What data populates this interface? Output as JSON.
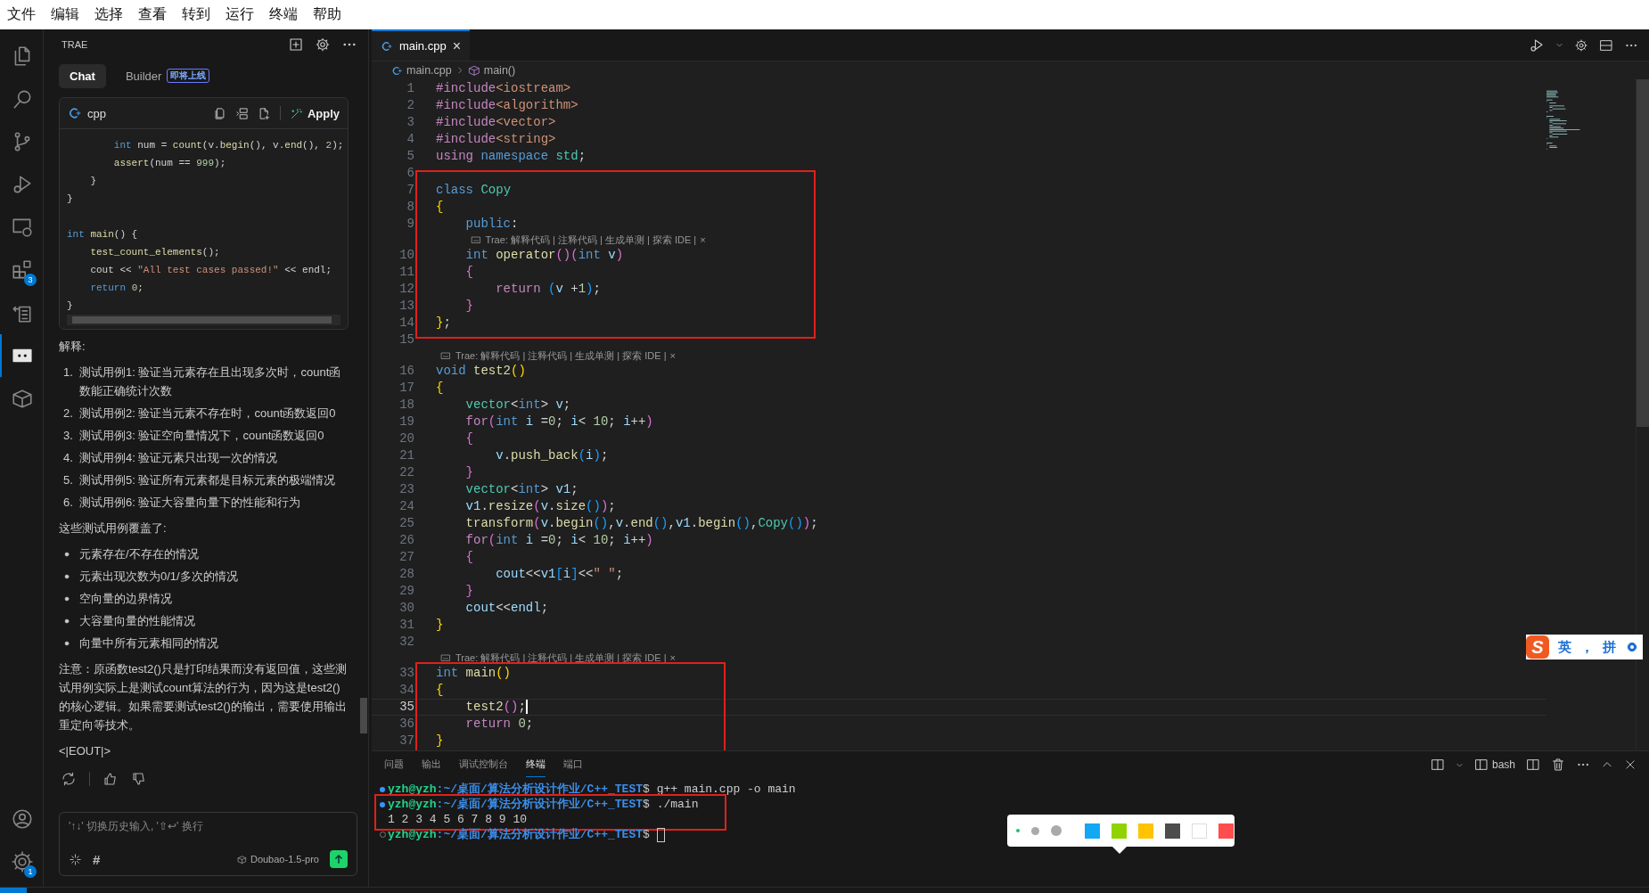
{
  "menu": [
    "文件",
    "编辑",
    "选择",
    "查看",
    "转到",
    "运行",
    "终端",
    "帮助"
  ],
  "activity_bar": {
    "items": [
      {
        "kind": "files",
        "selected": false
      },
      {
        "kind": "search",
        "selected": false
      },
      {
        "kind": "source-control",
        "selected": false
      },
      {
        "kind": "run-debug",
        "selected": false
      },
      {
        "kind": "remote",
        "selected": false
      },
      {
        "kind": "extensions",
        "selected": false,
        "badge": "3"
      },
      {
        "kind": "tasks",
        "selected": false
      },
      {
        "kind": "chat",
        "selected": true
      },
      {
        "kind": "box",
        "selected": false
      }
    ],
    "bottom": [
      {
        "kind": "account"
      },
      {
        "kind": "settings",
        "badge": "1"
      }
    ]
  },
  "chat_panel": {
    "title": "TRAE",
    "tabs": [
      {
        "label": "Chat",
        "selected": true
      },
      {
        "label": "Builder",
        "selected": false,
        "badge": "即将上线"
      }
    ],
    "code_block": {
      "language": "cpp",
      "apply": "Apply",
      "lines": [
        {
          "kind": "code",
          "tokens": [
            {
              "text": "        int",
              "kind": "kw"
            },
            {
              "text": " num = ",
              "kind": "p"
            },
            {
              "text": "count",
              "kind": "fn"
            },
            {
              "text": "(v.",
              "kind": "p"
            },
            {
              "text": "begin",
              "kind": "fn"
            },
            {
              "text": "(), v.",
              "kind": "p"
            },
            {
              "text": "end",
              "kind": "fn"
            },
            {
              "text": "(), ",
              "kind": "p"
            },
            {
              "text": "2",
              "kind": "num"
            },
            {
              "text": ");",
              "kind": "p"
            }
          ]
        },
        {
          "kind": "code",
          "tokens": [
            {
              "text": "        assert",
              "kind": "fn"
            },
            {
              "text": "(num == ",
              "kind": "p"
            },
            {
              "text": "999",
              "kind": "num"
            },
            {
              "text": ");",
              "kind": "p"
            }
          ]
        },
        {
          "kind": "code",
          "tokens": [
            {
              "text": "    }",
              "kind": "p"
            }
          ]
        },
        {
          "kind": "code",
          "tokens": [
            {
              "text": "}",
              "kind": "p"
            }
          ]
        },
        {
          "kind": "blank"
        },
        {
          "kind": "code",
          "tokens": [
            {
              "text": "int ",
              "kind": "kw"
            },
            {
              "text": "main",
              "kind": "fn"
            },
            {
              "text": "() {",
              "kind": "p"
            }
          ]
        },
        {
          "kind": "code",
          "tokens": [
            {
              "text": "    test_count_elements",
              "kind": "fn"
            },
            {
              "text": "();",
              "kind": "p"
            }
          ]
        },
        {
          "kind": "code",
          "tokens": [
            {
              "text": "    cout << ",
              "kind": "p"
            },
            {
              "text": "\"All test cases passed!\"",
              "kind": "str"
            },
            {
              "text": " << endl;",
              "kind": "p"
            }
          ]
        },
        {
          "kind": "code",
          "tokens": [
            {
              "text": "    return ",
              "kind": "kw"
            },
            {
              "text": "0",
              "kind": "num"
            },
            {
              "text": ";",
              "kind": "p"
            }
          ]
        },
        {
          "kind": "code",
          "tokens": [
            {
              "text": "}",
              "kind": "p"
            }
          ]
        }
      ]
    },
    "explanation": {
      "heading": "解释:",
      "steps": [
        {
          "n": "1.",
          "text": "测试用例1: 验证当元素存在且出现多次时，count函数能正确统计次数"
        },
        {
          "n": "2.",
          "text": "测试用例2: 验证当元素不存在时，count函数返回0"
        },
        {
          "n": "3.",
          "text": "测试用例3: 验证空向量情况下，count函数返回0"
        },
        {
          "n": "4.",
          "text": "测试用例4: 验证元素只出现一次的情况"
        },
        {
          "n": "5.",
          "text": "测试用例5: 验证所有元素都是目标元素的极端情况"
        },
        {
          "n": "6.",
          "text": "测试用例6: 验证大容量向量下的性能和行为"
        }
      ],
      "coverage_heading": "这些测试用例覆盖了:",
      "coverage": [
        "元素存在/不存在的情况",
        "元素出现次数为0/1/多次的情况",
        "空向量的边界情况",
        "大容量向量的性能情况",
        "向量中所有元素相同的情况"
      ],
      "note": "注意：原函数test2()只是打印结果而没有返回值，这些测试用例实际上是测试count算法的行为，因为这是test2()的核心逻辑。如果需要测试test2()的输出，需要使用输出重定向等技术。",
      "end_marker": "<|EOUT|>"
    },
    "input": {
      "placeholder": "'↑↓' 切换历史输入, '⇧↩' 换行",
      "hash": "#",
      "model": "Doubao-1.5-pro"
    }
  },
  "editor": {
    "tabs": [
      {
        "label": "main.cpp",
        "selected": true,
        "close": "×"
      }
    ],
    "breadcrumb": [
      "main.cpp",
      "main()"
    ],
    "blocks": [
      {
        "framed": false,
        "rows": [
          {
            "kind": "line",
            "n": "1",
            "current": false,
            "tokens": [
              {
                "text": "#include",
                "kind": "pp"
              },
              {
                "text": "<iostream>",
                "kind": "str"
              }
            ]
          },
          {
            "kind": "line",
            "n": "2",
            "current": false,
            "tokens": [
              {
                "text": "#include",
                "kind": "pp"
              },
              {
                "text": "<algorithm>",
                "kind": "str"
              }
            ]
          },
          {
            "kind": "line",
            "n": "3",
            "current": false,
            "tokens": [
              {
                "text": "#include",
                "kind": "pp"
              },
              {
                "text": "<vector>",
                "kind": "str"
              }
            ]
          },
          {
            "kind": "line",
            "n": "4",
            "current": false,
            "tokens": [
              {
                "text": "#include",
                "kind": "pp"
              },
              {
                "text": "<string>",
                "kind": "str"
              }
            ]
          },
          {
            "kind": "line",
            "n": "5",
            "current": false,
            "tokens": [
              {
                "text": "using ",
                "kind": "ctl"
              },
              {
                "text": "namespace ",
                "kind": "kw"
              },
              {
                "text": "std",
                "kind": "type"
              },
              {
                "text": ";",
                "kind": "p"
              }
            ]
          }
        ]
      },
      {
        "framed": true,
        "rows": [
          {
            "kind": "line",
            "n": "6",
            "current": false
          },
          {
            "kind": "line",
            "n": "7",
            "current": false,
            "tokens": [
              {
                "text": "class ",
                "kind": "kw"
              },
              {
                "text": "Copy",
                "kind": "type"
              }
            ]
          },
          {
            "kind": "line",
            "n": "8",
            "current": false,
            "tokens": [
              {
                "text": "{",
                "kind": "b1"
              }
            ]
          },
          {
            "kind": "line",
            "n": "9",
            "current": false,
            "tokens": [
              {
                "text": "    public",
                "kind": "kw"
              },
              {
                "text": ":",
                "kind": "p"
              }
            ]
          },
          {
            "kind": "lens",
            "text": "Trae: 解释代码 | 注释代码 | 生成单测 | 探索 IDE |",
            "close": "×"
          },
          {
            "kind": "line",
            "n": "10",
            "current": false,
            "tokens": [
              {
                "text": "    int ",
                "kind": "kw"
              },
              {
                "text": "operator",
                "kind": "fn"
              },
              {
                "text": "()",
                "kind": "b2"
              },
              {
                "text": "(",
                "kind": "b2"
              },
              {
                "text": "int",
                "kind": "kw"
              },
              {
                "text": " v",
                "kind": "var"
              },
              {
                "text": ")",
                "kind": "b2"
              }
            ]
          },
          {
            "kind": "line",
            "n": "11",
            "current": false,
            "tokens": [
              {
                "text": "    {",
                "kind": "b2"
              }
            ]
          },
          {
            "kind": "line",
            "n": "12",
            "current": false,
            "tokens": [
              {
                "text": "        return ",
                "kind": "ctl"
              },
              {
                "text": "(",
                "kind": "b3"
              },
              {
                "text": "v",
                "kind": "var"
              },
              {
                "text": " +",
                "kind": "p"
              },
              {
                "text": "1",
                "kind": "num"
              },
              {
                "text": ")",
                "kind": "b3"
              },
              {
                "text": ";",
                "kind": "p"
              }
            ]
          },
          {
            "kind": "line",
            "n": "13",
            "current": false,
            "tokens": [
              {
                "text": "    }",
                "kind": "b2"
              }
            ]
          },
          {
            "kind": "line",
            "n": "14",
            "current": false,
            "tokens": [
              {
                "text": "}",
                "kind": "b1"
              },
              {
                "text": ";",
                "kind": "p"
              }
            ]
          }
        ]
      },
      {
        "framed": false,
        "rows": [
          {
            "kind": "line",
            "n": "15",
            "current": false
          },
          {
            "kind": "lens",
            "text": "Trae: 解释代码 | 注释代码 | 生成单测 | 探索 IDE |",
            "close": "×"
          },
          {
            "kind": "line",
            "n": "16",
            "current": false,
            "tokens": [
              {
                "text": "void ",
                "kind": "kw"
              },
              {
                "text": "test2",
                "kind": "fn"
              },
              {
                "text": "()",
                "kind": "b1"
              }
            ]
          },
          {
            "kind": "line",
            "n": "17",
            "current": false,
            "tokens": [
              {
                "text": "{",
                "kind": "b1"
              }
            ]
          },
          {
            "kind": "line",
            "n": "18",
            "current": false,
            "tokens": [
              {
                "text": "    vector",
                "kind": "type"
              },
              {
                "text": "<",
                "kind": "p"
              },
              {
                "text": "int",
                "kind": "kw"
              },
              {
                "text": "> ",
                "kind": "p"
              },
              {
                "text": "v",
                "kind": "var"
              },
              {
                "text": ";",
                "kind": "p"
              }
            ]
          },
          {
            "kind": "line",
            "n": "19",
            "current": false,
            "tokens": [
              {
                "text": "    for",
                "kind": "ctl"
              },
              {
                "text": "(",
                "kind": "b2"
              },
              {
                "text": "int",
                "kind": "kw"
              },
              {
                "text": " i ",
                "kind": "var"
              },
              {
                "text": "=",
                "kind": "p"
              },
              {
                "text": "0",
                "kind": "num"
              },
              {
                "text": "; ",
                "kind": "p"
              },
              {
                "text": "i",
                "kind": "var"
              },
              {
                "text": "< ",
                "kind": "p"
              },
              {
                "text": "10",
                "kind": "num"
              },
              {
                "text": "; ",
                "kind": "p"
              },
              {
                "text": "i",
                "kind": "var"
              },
              {
                "text": "++",
                "kind": "p"
              },
              {
                "text": ")",
                "kind": "b2"
              }
            ]
          },
          {
            "kind": "line",
            "n": "20",
            "current": false,
            "tokens": [
              {
                "text": "    {",
                "kind": "b2"
              }
            ]
          },
          {
            "kind": "line",
            "n": "21",
            "current": false,
            "tokens": [
              {
                "text": "        v",
                "kind": "var"
              },
              {
                "text": ".",
                "kind": "p"
              },
              {
                "text": "push_back",
                "kind": "fn"
              },
              {
                "text": "(",
                "kind": "b3"
              },
              {
                "text": "i",
                "kind": "var"
              },
              {
                "text": ")",
                "kind": "b3"
              },
              {
                "text": ";",
                "kind": "p"
              }
            ]
          },
          {
            "kind": "line",
            "n": "22",
            "current": false,
            "tokens": [
              {
                "text": "    }",
                "kind": "b2"
              }
            ]
          },
          {
            "kind": "line",
            "n": "23",
            "current": false,
            "tokens": [
              {
                "text": "    vector",
                "kind": "type"
              },
              {
                "text": "<",
                "kind": "p"
              },
              {
                "text": "int",
                "kind": "kw"
              },
              {
                "text": "> ",
                "kind": "p"
              },
              {
                "text": "v1",
                "kind": "var"
              },
              {
                "text": ";",
                "kind": "p"
              }
            ]
          },
          {
            "kind": "line",
            "n": "24",
            "current": false,
            "tokens": [
              {
                "text": "    v1",
                "kind": "var"
              },
              {
                "text": ".",
                "kind": "p"
              },
              {
                "text": "resize",
                "kind": "fn"
              },
              {
                "text": "(",
                "kind": "b2"
              },
              {
                "text": "v",
                "kind": "var"
              },
              {
                "text": ".",
                "kind": "p"
              },
              {
                "text": "size",
                "kind": "fn"
              },
              {
                "text": "()",
                "kind": "b3"
              },
              {
                "text": ")",
                "kind": "b2"
              },
              {
                "text": ";",
                "kind": "p"
              }
            ]
          },
          {
            "kind": "line",
            "n": "25",
            "current": false,
            "tokens": [
              {
                "text": "    transform",
                "kind": "fn"
              },
              {
                "text": "(",
                "kind": "b2"
              },
              {
                "text": "v",
                "kind": "var"
              },
              {
                "text": ".",
                "kind": "p"
              },
              {
                "text": "begin",
                "kind": "fn"
              },
              {
                "text": "()",
                "kind": "b3"
              },
              {
                "text": ",",
                "kind": "p"
              },
              {
                "text": "v",
                "kind": "var"
              },
              {
                "text": ".",
                "kind": "p"
              },
              {
                "text": "end",
                "kind": "fn"
              },
              {
                "text": "()",
                "kind": "b3"
              },
              {
                "text": ",",
                "kind": "p"
              },
              {
                "text": "v1",
                "kind": "var"
              },
              {
                "text": ".",
                "kind": "p"
              },
              {
                "text": "begin",
                "kind": "fn"
              },
              {
                "text": "()",
                "kind": "b3"
              },
              {
                "text": ",",
                "kind": "p"
              },
              {
                "text": "Copy",
                "kind": "type"
              },
              {
                "text": "()",
                "kind": "b3"
              },
              {
                "text": ")",
                "kind": "b2"
              },
              {
                "text": ";",
                "kind": "p"
              }
            ]
          },
          {
            "kind": "line",
            "n": "26",
            "current": false,
            "tokens": [
              {
                "text": "    for",
                "kind": "ctl"
              },
              {
                "text": "(",
                "kind": "b2"
              },
              {
                "text": "int",
                "kind": "kw"
              },
              {
                "text": " i ",
                "kind": "var"
              },
              {
                "text": "=",
                "kind": "p"
              },
              {
                "text": "0",
                "kind": "num"
              },
              {
                "text": "; ",
                "kind": "p"
              },
              {
                "text": "i",
                "kind": "var"
              },
              {
                "text": "< ",
                "kind": "p"
              },
              {
                "text": "10",
                "kind": "num"
              },
              {
                "text": "; ",
                "kind": "p"
              },
              {
                "text": "i",
                "kind": "var"
              },
              {
                "text": "++",
                "kind": "p"
              },
              {
                "text": ")",
                "kind": "b2"
              }
            ]
          },
          {
            "kind": "line",
            "n": "27",
            "current": false,
            "tokens": [
              {
                "text": "    {",
                "kind": "b2"
              }
            ]
          },
          {
            "kind": "line",
            "n": "28",
            "current": false,
            "tokens": [
              {
                "text": "        cout",
                "kind": "var"
              },
              {
                "text": "<<",
                "kind": "p"
              },
              {
                "text": "v1",
                "kind": "var"
              },
              {
                "text": "[",
                "kind": "b3"
              },
              {
                "text": "i",
                "kind": "var"
              },
              {
                "text": "]",
                "kind": "b3"
              },
              {
                "text": "<<",
                "kind": "p"
              },
              {
                "text": "\" \"",
                "kind": "str"
              },
              {
                "text": ";",
                "kind": "p"
              }
            ]
          },
          {
            "kind": "line",
            "n": "29",
            "current": false,
            "tokens": [
              {
                "text": "    }",
                "kind": "b2"
              }
            ]
          },
          {
            "kind": "line",
            "n": "30",
            "current": false,
            "tokens": [
              {
                "text": "    cout",
                "kind": "var"
              },
              {
                "text": "<<",
                "kind": "p"
              },
              {
                "text": "endl",
                "kind": "var"
              },
              {
                "text": ";",
                "kind": "p"
              }
            ]
          },
          {
            "kind": "line",
            "n": "31",
            "current": false,
            "tokens": [
              {
                "text": "}",
                "kind": "b1"
              }
            ]
          },
          {
            "kind": "line",
            "n": "32",
            "current": false
          },
          {
            "kind": "lens",
            "text": "Trae: 解释代码 | 注释代码 | 生成单测 | 探索 IDE |",
            "close": "×"
          }
        ]
      },
      {
        "framed": true,
        "rows": [
          {
            "kind": "line",
            "n": "33",
            "current": false,
            "tokens": [
              {
                "text": "int ",
                "kind": "kw"
              },
              {
                "text": "main",
                "kind": "fn"
              },
              {
                "text": "()",
                "kind": "b1"
              }
            ]
          },
          {
            "kind": "line",
            "n": "34",
            "current": false,
            "tokens": [
              {
                "text": "{",
                "kind": "b1"
              }
            ]
          },
          {
            "kind": "line",
            "n": "35",
            "current": true,
            "tokens": [
              {
                "text": "    test2",
                "kind": "fn"
              },
              {
                "text": "()",
                "kind": "b2"
              },
              {
                "text": ";",
                "kind": "p"
              }
            ]
          },
          {
            "kind": "line",
            "n": "36",
            "current": false,
            "tokens": [
              {
                "text": "    return ",
                "kind": "ctl"
              },
              {
                "text": "0",
                "kind": "num"
              },
              {
                "text": ";",
                "kind": "p"
              }
            ]
          },
          {
            "kind": "line",
            "n": "37",
            "current": false,
            "tokens": [
              {
                "text": "}",
                "kind": "b1"
              }
            ]
          }
        ]
      }
    ]
  },
  "panel": {
    "tabs": [
      {
        "label": "问题",
        "selected": false
      },
      {
        "label": "输出",
        "selected": false
      },
      {
        "label": "调试控制台",
        "selected": false
      },
      {
        "label": "终端",
        "selected": true
      },
      {
        "label": "端口",
        "selected": false
      }
    ],
    "shell": "bash",
    "terminal": [
      {
        "framed": false,
        "lines": [
          {
            "kind": "prompt",
            "succeeded": true,
            "user": "yzh@yzh",
            "path": ":~/桌面/算法分析设计作业/C++_TEST",
            "command": "$ g++ main.cpp -o main",
            "cursor": false
          }
        ]
      },
      {
        "framed": true,
        "lines": [
          {
            "kind": "prompt",
            "succeeded": true,
            "user": "yzh@yzh",
            "path": ":~/桌面/算法分析设计作业/C++_TEST",
            "command": "$ ./main",
            "cursor": false
          },
          {
            "kind": "output",
            "text": "1 2 3 4 5 6 7 8 9 10"
          }
        ]
      },
      {
        "framed": false,
        "lines": [
          {
            "kind": "prompt",
            "succeeded": false,
            "user": "yzh@yzh",
            "path": ":~/桌面/算法分析设计作业/C++_TEST",
            "command": "$",
            "cursor": true
          }
        ]
      }
    ]
  },
  "ime": {
    "logo": "S",
    "mode": "英",
    "punct": "，",
    "layout": "拼"
  },
  "palette": {
    "sizes": [
      {
        "selected": true
      },
      {
        "selected": false
      },
      {
        "selected": false
      }
    ],
    "colors": [
      {
        "color": "#12a8f5"
      },
      {
        "color": "#8fd400"
      },
      {
        "color": "#ffc300"
      },
      {
        "color": "#4d4d4d"
      },
      {
        "color": "#ffffff"
      },
      {
        "color": "#ff4d4d"
      }
    ]
  }
}
